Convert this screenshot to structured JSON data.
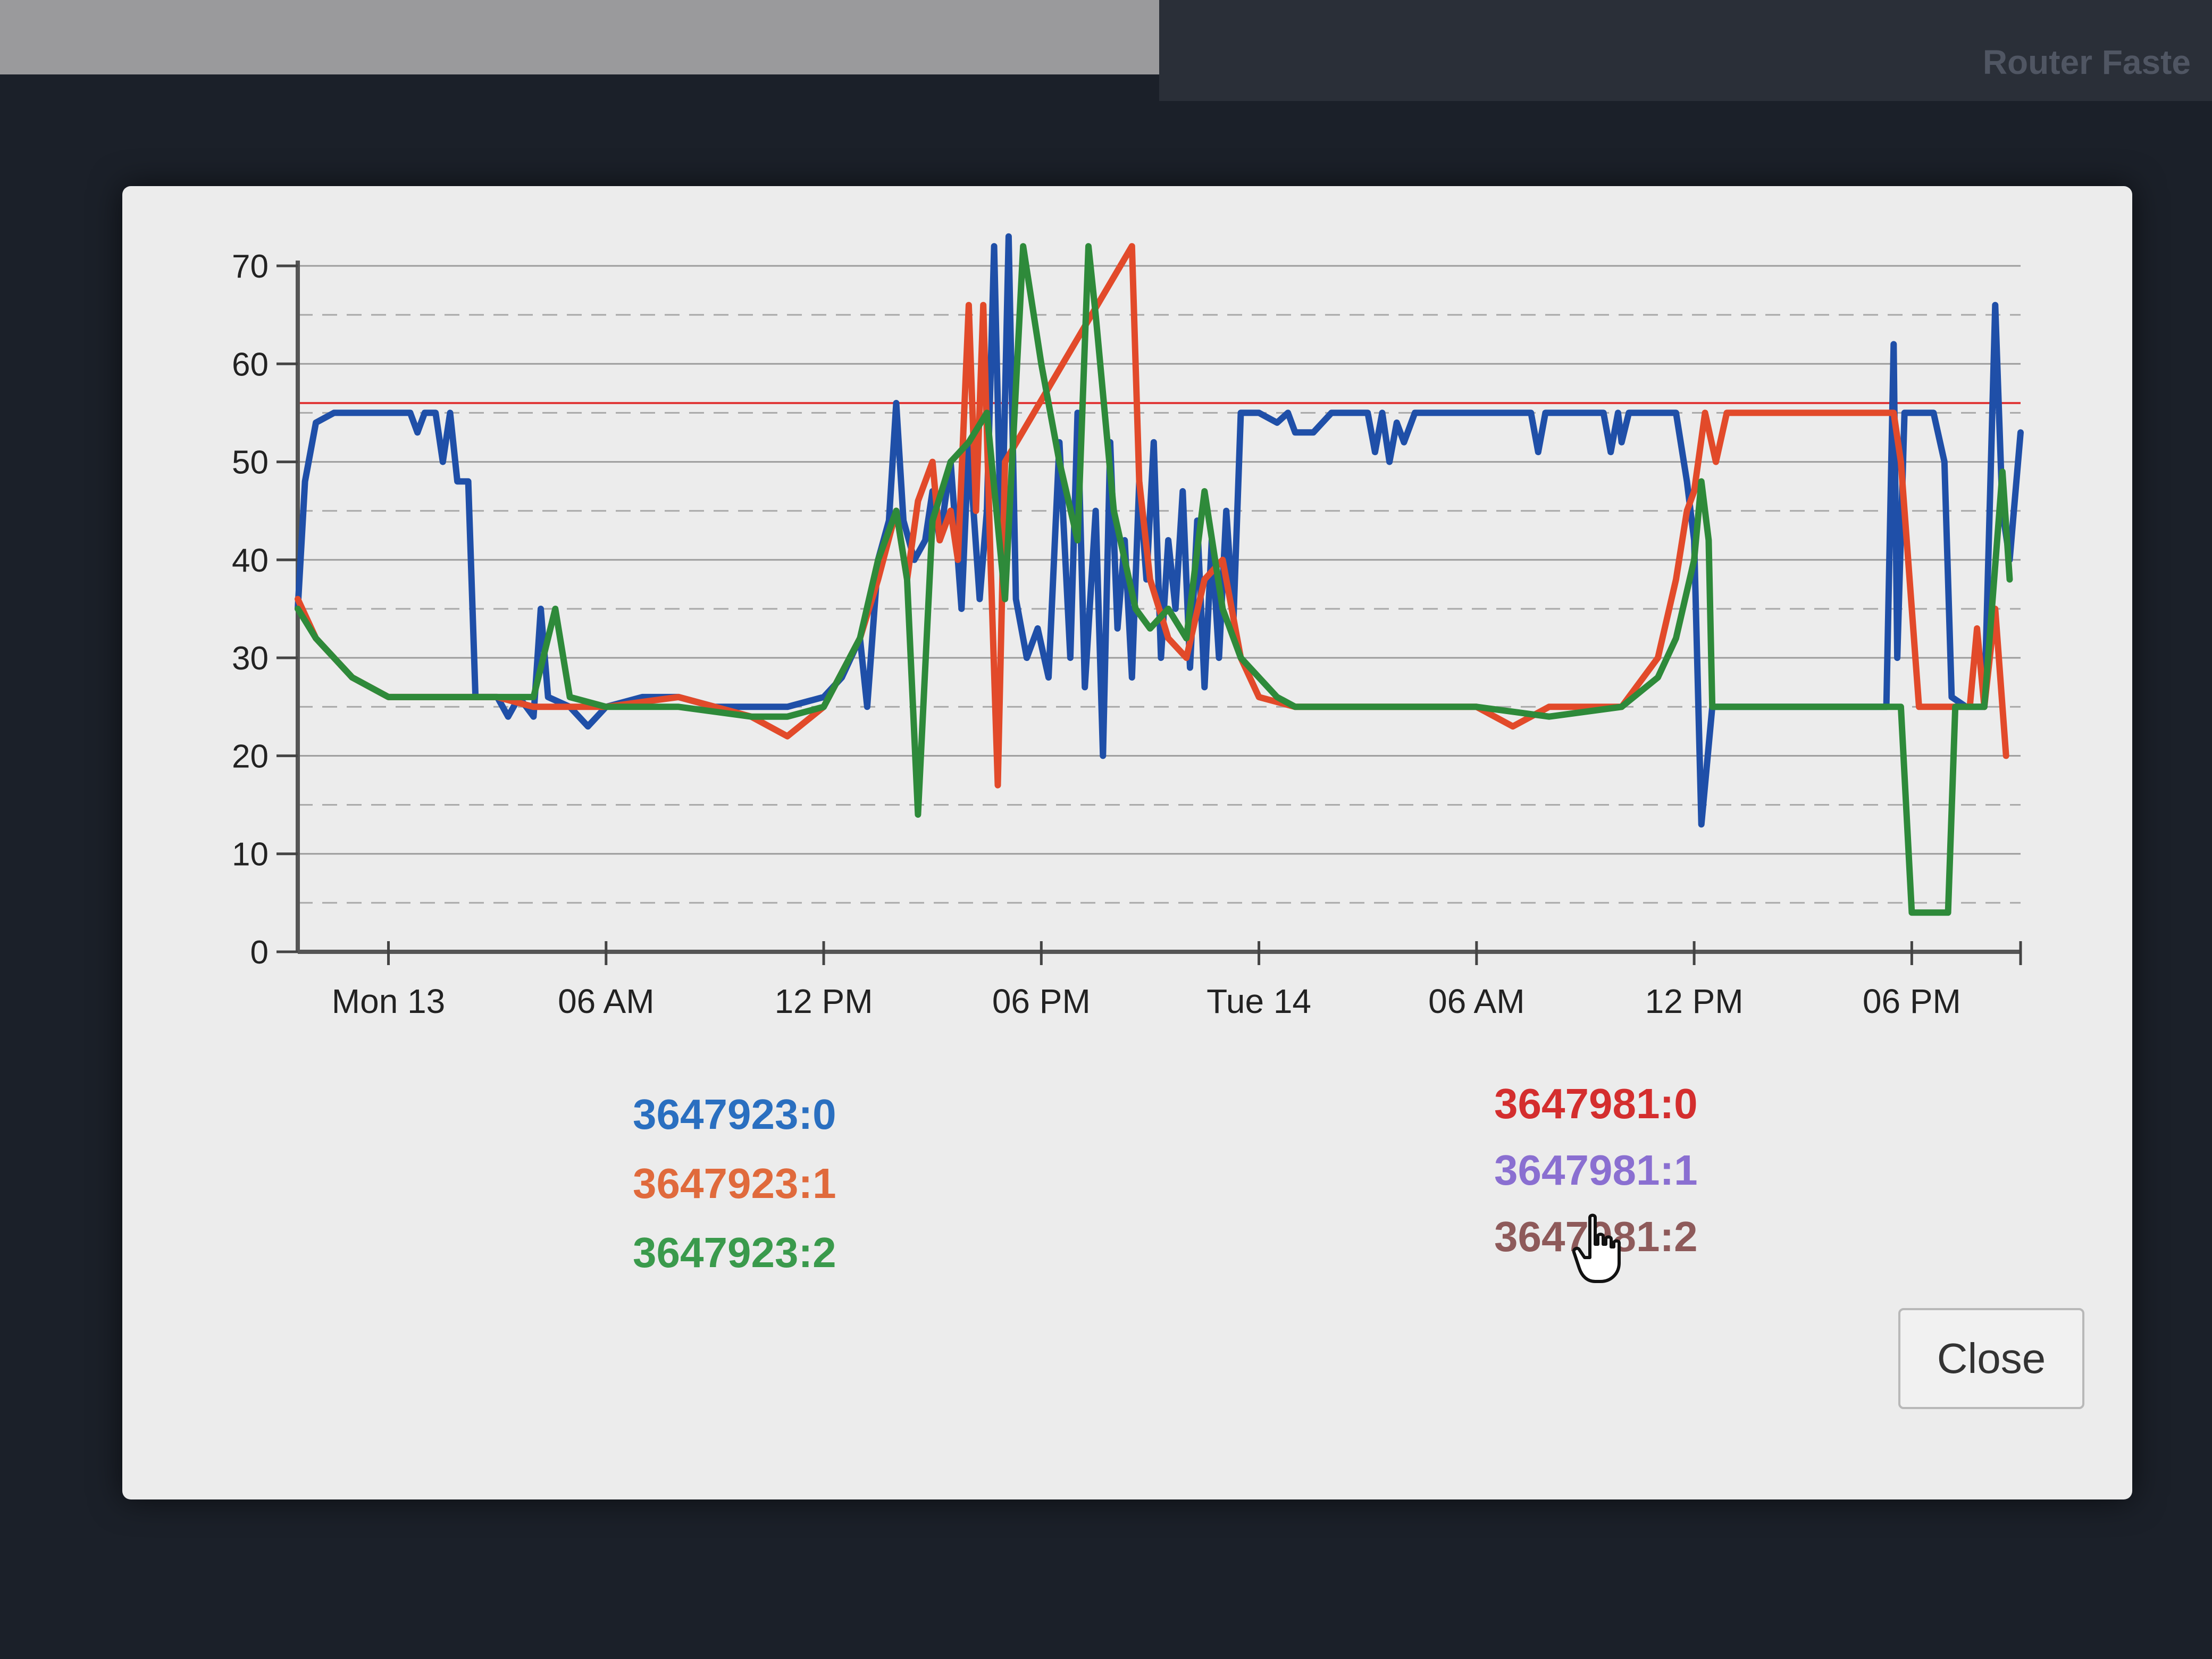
{
  "background": {
    "top_title": "Router Faste"
  },
  "dialog": {
    "close_label": "Close"
  },
  "chart_data": {
    "type": "line",
    "title": "",
    "xlabel": "",
    "ylabel": "",
    "ylim": [
      0,
      70
    ],
    "xlim_hours": [
      -2.5,
      45
    ],
    "yticks": [
      0,
      10,
      20,
      30,
      40,
      50,
      60,
      70
    ],
    "xticks": [
      {
        "h": 0,
        "label": "Mon 13"
      },
      {
        "h": 6,
        "label": "06 AM"
      },
      {
        "h": 12,
        "label": "12 PM"
      },
      {
        "h": 18,
        "label": "06 PM"
      },
      {
        "h": 24,
        "label": "Tue 14"
      },
      {
        "h": 30,
        "label": "06 AM"
      },
      {
        "h": 36,
        "label": "12 PM"
      },
      {
        "h": 42,
        "label": "06 PM"
      }
    ],
    "grid": true,
    "legend_position": "bottom",
    "threshold": {
      "value": 56,
      "color": "#e03a3a"
    },
    "series": [
      {
        "name": "3647923:0",
        "color": "#1f4fa8",
        "points": [
          [
            -2.5,
            35
          ],
          [
            -2.3,
            48
          ],
          [
            -2,
            54
          ],
          [
            -1.5,
            55
          ],
          [
            0,
            55
          ],
          [
            0.6,
            55
          ],
          [
            0.8,
            53
          ],
          [
            1,
            55
          ],
          [
            1.3,
            55
          ],
          [
            1.5,
            50
          ],
          [
            1.7,
            55
          ],
          [
            1.9,
            48
          ],
          [
            2.2,
            48
          ],
          [
            2.4,
            26
          ],
          [
            3,
            26
          ],
          [
            3.3,
            24
          ],
          [
            3.6,
            26
          ],
          [
            4,
            24
          ],
          [
            4.2,
            35
          ],
          [
            4.4,
            26
          ],
          [
            5,
            25
          ],
          [
            5.5,
            23
          ],
          [
            6,
            25
          ],
          [
            7,
            26
          ],
          [
            8,
            26
          ],
          [
            9,
            25
          ],
          [
            10,
            25
          ],
          [
            11,
            25
          ],
          [
            12,
            26
          ],
          [
            12.5,
            28
          ],
          [
            13,
            32
          ],
          [
            13.2,
            25
          ],
          [
            13.5,
            40
          ],
          [
            13.8,
            44
          ],
          [
            14,
            56
          ],
          [
            14.2,
            44
          ],
          [
            14.5,
            40
          ],
          [
            14.8,
            42
          ],
          [
            15,
            47
          ],
          [
            15.2,
            42
          ],
          [
            15.5,
            50
          ],
          [
            15.8,
            35
          ],
          [
            16,
            52
          ],
          [
            16.3,
            36
          ],
          [
            16.5,
            45
          ],
          [
            16.7,
            72
          ],
          [
            16.9,
            40
          ],
          [
            17.1,
            73
          ],
          [
            17.3,
            36
          ],
          [
            17.6,
            30
          ],
          [
            17.9,
            33
          ],
          [
            18.2,
            28
          ],
          [
            18.5,
            52
          ],
          [
            18.8,
            30
          ],
          [
            19,
            55
          ],
          [
            19.2,
            27
          ],
          [
            19.5,
            45
          ],
          [
            19.7,
            20
          ],
          [
            19.9,
            52
          ],
          [
            20.1,
            33
          ],
          [
            20.3,
            42
          ],
          [
            20.5,
            28
          ],
          [
            20.7,
            48
          ],
          [
            20.9,
            38
          ],
          [
            21.1,
            52
          ],
          [
            21.3,
            30
          ],
          [
            21.5,
            42
          ],
          [
            21.7,
            35
          ],
          [
            21.9,
            47
          ],
          [
            22.1,
            29
          ],
          [
            22.3,
            44
          ],
          [
            22.5,
            27
          ],
          [
            22.7,
            42
          ],
          [
            22.9,
            30
          ],
          [
            23.1,
            45
          ],
          [
            23.3,
            34
          ],
          [
            23.5,
            55
          ],
          [
            24,
            55
          ],
          [
            24.5,
            54
          ],
          [
            24.8,
            55
          ],
          [
            25,
            53
          ],
          [
            25.5,
            53
          ],
          [
            26,
            55
          ],
          [
            27,
            55
          ],
          [
            27.2,
            51
          ],
          [
            27.4,
            55
          ],
          [
            27.6,
            50
          ],
          [
            27.8,
            54
          ],
          [
            28,
            52
          ],
          [
            28.3,
            55
          ],
          [
            30,
            55
          ],
          [
            31.5,
            55
          ],
          [
            31.7,
            51
          ],
          [
            31.9,
            55
          ],
          [
            33,
            55
          ],
          [
            33.5,
            55
          ],
          [
            33.7,
            51
          ],
          [
            33.9,
            55
          ],
          [
            34,
            52
          ],
          [
            34.2,
            55
          ],
          [
            35.5,
            55
          ],
          [
            35.8,
            48
          ],
          [
            36,
            42
          ],
          [
            36.2,
            13
          ],
          [
            36.5,
            25
          ],
          [
            38,
            25
          ],
          [
            40,
            25
          ],
          [
            41.3,
            25
          ],
          [
            41.5,
            62
          ],
          [
            41.6,
            30
          ],
          [
            41.8,
            55
          ],
          [
            42.2,
            55
          ],
          [
            42.6,
            55
          ],
          [
            42.9,
            50
          ],
          [
            43.1,
            26
          ],
          [
            43.5,
            25
          ],
          [
            44,
            25
          ],
          [
            44.3,
            66
          ],
          [
            44.5,
            45
          ],
          [
            44.7,
            40
          ],
          [
            45,
            53
          ]
        ]
      },
      {
        "name": "3647923:1",
        "color": "#e24a2a",
        "points": [
          [
            -2.5,
            36
          ],
          [
            -2,
            32
          ],
          [
            -1,
            28
          ],
          [
            0,
            26
          ],
          [
            1,
            26
          ],
          [
            3,
            26
          ],
          [
            4,
            25
          ],
          [
            6,
            25
          ],
          [
            8,
            26
          ],
          [
            10,
            24
          ],
          [
            11,
            22
          ],
          [
            12,
            25
          ],
          [
            13,
            32
          ],
          [
            13.5,
            38
          ],
          [
            14,
            45
          ],
          [
            14.3,
            38
          ],
          [
            14.6,
            46
          ],
          [
            15,
            50
          ],
          [
            15.2,
            42
          ],
          [
            15.5,
            45
          ],
          [
            15.7,
            40
          ],
          [
            16,
            66
          ],
          [
            16.2,
            45
          ],
          [
            16.4,
            66
          ],
          [
            16.6,
            40
          ],
          [
            16.8,
            17
          ],
          [
            17,
            50
          ],
          [
            20.5,
            72
          ],
          [
            20.7,
            48
          ],
          [
            21,
            38
          ],
          [
            21.5,
            32
          ],
          [
            22,
            30
          ],
          [
            22.5,
            38
          ],
          [
            23,
            40
          ],
          [
            23.5,
            30
          ],
          [
            24,
            26
          ],
          [
            25,
            25
          ],
          [
            26,
            25
          ],
          [
            28,
            25
          ],
          [
            30,
            25
          ],
          [
            31,
            23
          ],
          [
            32,
            25
          ],
          [
            34,
            25
          ],
          [
            35,
            30
          ],
          [
            35.5,
            38
          ],
          [
            35.8,
            45
          ],
          [
            36,
            47
          ],
          [
            36.3,
            55
          ],
          [
            36.6,
            50
          ],
          [
            36.9,
            55
          ],
          [
            38,
            55
          ],
          [
            40,
            55
          ],
          [
            41.5,
            55
          ],
          [
            41.7,
            50
          ],
          [
            42,
            35
          ],
          [
            42.2,
            25
          ],
          [
            43,
            25
          ],
          [
            43.6,
            25
          ],
          [
            43.8,
            33
          ],
          [
            44,
            25
          ],
          [
            44.3,
            35
          ],
          [
            44.6,
            20
          ]
        ]
      },
      {
        "name": "3647923:2",
        "color": "#2e8a3a",
        "points": [
          [
            -2.5,
            35
          ],
          [
            -2,
            32
          ],
          [
            -1,
            28
          ],
          [
            0,
            26
          ],
          [
            1,
            26
          ],
          [
            2,
            26
          ],
          [
            3,
            26
          ],
          [
            4,
            26
          ],
          [
            4.6,
            35
          ],
          [
            5,
            26
          ],
          [
            6,
            25
          ],
          [
            8,
            25
          ],
          [
            10,
            24
          ],
          [
            11,
            24
          ],
          [
            12,
            25
          ],
          [
            13,
            32
          ],
          [
            13.5,
            40
          ],
          [
            14,
            45
          ],
          [
            14.3,
            38
          ],
          [
            14.6,
            14
          ],
          [
            15,
            44
          ],
          [
            15.5,
            50
          ],
          [
            16,
            52
          ],
          [
            16.5,
            55
          ],
          [
            17,
            36
          ],
          [
            17.5,
            72
          ],
          [
            18,
            60
          ],
          [
            18.5,
            50
          ],
          [
            19,
            42
          ],
          [
            19.3,
            72
          ],
          [
            19.5,
            65
          ],
          [
            20,
            45
          ],
          [
            20.3,
            40
          ],
          [
            20.6,
            35
          ],
          [
            21,
            33
          ],
          [
            21.5,
            35
          ],
          [
            22,
            32
          ],
          [
            22.5,
            47
          ],
          [
            23,
            35
          ],
          [
            23.5,
            30
          ],
          [
            24,
            28
          ],
          [
            24.5,
            26
          ],
          [
            25,
            25
          ],
          [
            27,
            25
          ],
          [
            30,
            25
          ],
          [
            32,
            24
          ],
          [
            34,
            25
          ],
          [
            35,
            28
          ],
          [
            35.5,
            32
          ],
          [
            36,
            40
          ],
          [
            36.2,
            48
          ],
          [
            36.4,
            42
          ],
          [
            36.5,
            25
          ],
          [
            38,
            25
          ],
          [
            40,
            25
          ],
          [
            41,
            25
          ],
          [
            41.7,
            25
          ],
          [
            42,
            4
          ],
          [
            43,
            4
          ],
          [
            43.2,
            25
          ],
          [
            44,
            25
          ],
          [
            44.5,
            49
          ],
          [
            44.7,
            38
          ]
        ]
      },
      {
        "name": "3647981:0",
        "color": "#d42e2e",
        "points": []
      },
      {
        "name": "3647981:1",
        "color": "#8a6fd1",
        "points": []
      },
      {
        "name": "3647981:2",
        "color": "#8e5a5a",
        "points": []
      }
    ]
  }
}
